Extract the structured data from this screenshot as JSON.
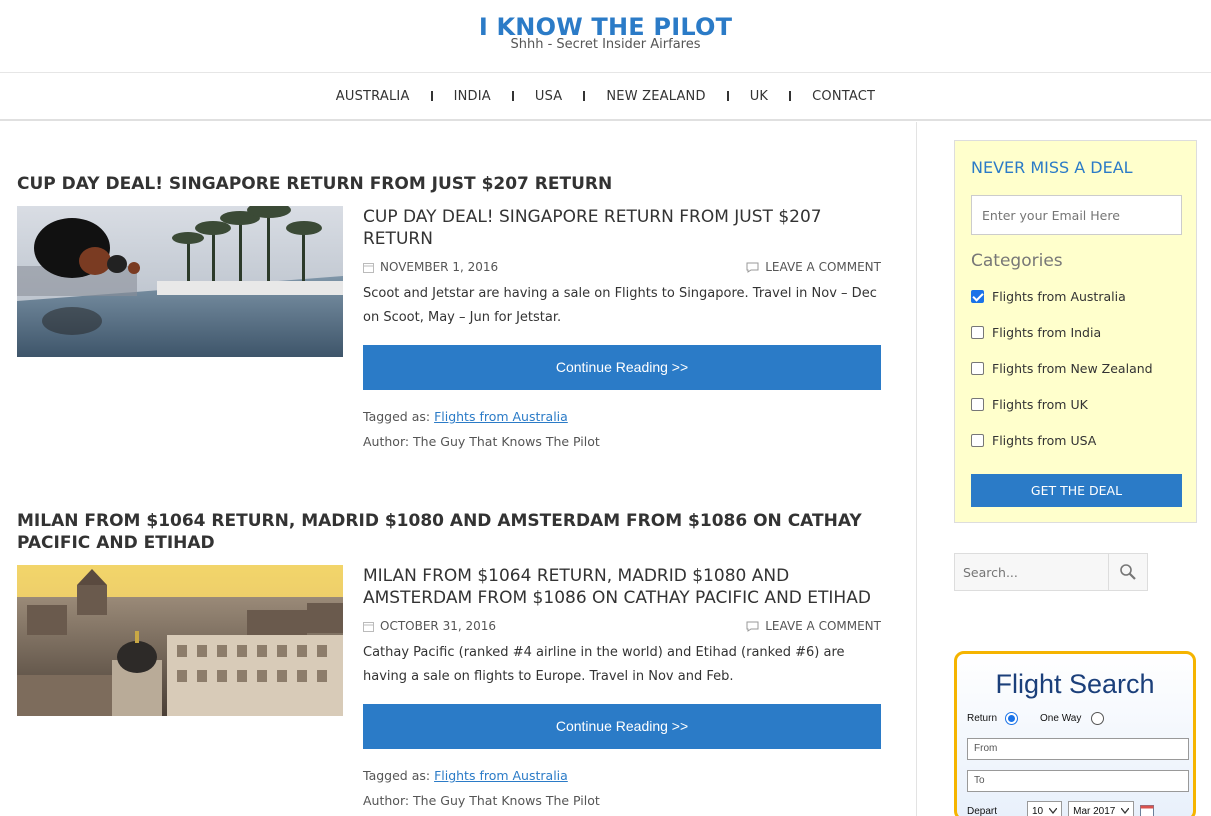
{
  "site": {
    "title": "I KNOW THE PILOT",
    "tagline": "Shhh - Secret Insider Airfares"
  },
  "nav": {
    "items": [
      "AUSTRALIA",
      "INDIA",
      "USA",
      "NEW ZEALAND",
      "UK",
      "CONTACT"
    ]
  },
  "posts": [
    {
      "heading": " CUP DAY DEAL! SINGAPORE RETURN FROM JUST $207 RETURN",
      "title": " CUP DAY DEAL! SINGAPORE RETURN FROM JUST $207 RETURN",
      "date": "NOVEMBER 1, 2016",
      "comment": "LEAVE A COMMENT",
      "excerpt": "Scoot and Jetstar are having a sale on Flights to Singapore. Travel in Nov – Dec on Scoot, May – Jun for Jetstar.",
      "button": "Continue Reading >>",
      "tagged_label": "Tagged as: ",
      "tag": "Flights from Australia",
      "author": "Author: The Guy That Knows The Pilot"
    },
    {
      "heading": "MILAN FROM $1064 RETURN, MADRID $1080 AND AMSTERDAM FROM $1086 ON CATHAY PACIFIC AND ETIHAD",
      "title": "MILAN FROM $1064 RETURN, MADRID $1080 AND AMSTERDAM FROM $1086 ON CATHAY PACIFIC AND ETIHAD",
      "date": "OCTOBER 31, 2016",
      "comment": "LEAVE A COMMENT",
      "excerpt": "Cathay Pacific (ranked #4 airline in the world) and Etihad (ranked #6) are having a sale on flights to Europe. Travel in Nov and Feb.",
      "button": "Continue Reading >>",
      "tagged_label": "Tagged as: ",
      "tag": "Flights from Australia",
      "author": "Author: The Guy That Knows The Pilot"
    }
  ],
  "sidebar": {
    "deal_title": "NEVER MISS A DEAL",
    "email_placeholder": "Enter your Email Here",
    "categories_title": "Categories",
    "categories": [
      {
        "label": "Flights from Australia",
        "checked": true
      },
      {
        "label": "Flights from India",
        "checked": false
      },
      {
        "label": "Flights from New Zealand",
        "checked": false
      },
      {
        "label": "Flights from UK",
        "checked": false
      },
      {
        "label": "Flights from USA",
        "checked": false
      }
    ],
    "get_deal": "GET THE DEAL",
    "search_placeholder": "Search..."
  },
  "flight": {
    "title": "Flight Search",
    "return_label": "Return",
    "oneway_label": "One Way",
    "from_placeholder": "From",
    "to_placeholder": "To",
    "depart_label": "Depart",
    "depart_day": "10",
    "depart_month": "Mar 2017"
  },
  "colors": {
    "accent": "#2b7bc7",
    "deal_bg": "#ffffcc",
    "flight_border": "#f5b400"
  }
}
